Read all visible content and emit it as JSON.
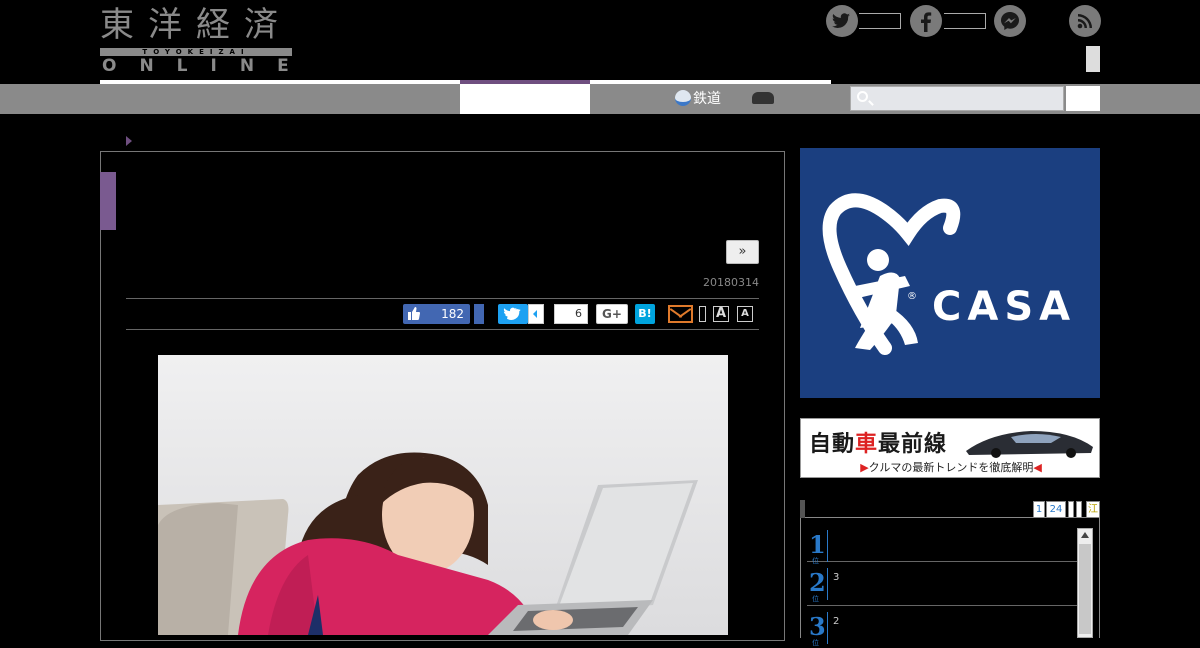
{
  "header": {
    "logo_kanji": "東洋経済",
    "logo_romaji": "TOYOKEIZAI",
    "logo_online": "ONLINE"
  },
  "social": {
    "twitter_icon": "twitter-bird-icon",
    "facebook_icon": "facebook-f-icon",
    "messenger_icon": "messenger-icon",
    "rss_icon": "rss-icon"
  },
  "nav": {
    "items": [
      {
        "label": "鉄道",
        "icon": "train-icon"
      },
      {
        "label": "",
        "icon": "car-icon"
      }
    ],
    "search_placeholder": ""
  },
  "article": {
    "next_label": "»",
    "date": "20180314",
    "like_count": "182",
    "share_count": "6",
    "gplus_label": "G+",
    "hatena_label": "B!",
    "font_large_label": "A",
    "font_small_label": "A"
  },
  "sidebar": {
    "ad_casa": {
      "brand": "CASA",
      "registered": "®",
      "colors": {
        "bg": "#1b3f80",
        "fg": "#ffffff"
      }
    },
    "ad_auto": {
      "title_1": "自動",
      "title_2": "車",
      "title_3": "最前線",
      "subtitle": "クルマの最新トレンドを徹底解明"
    },
    "ranking": {
      "tabs": [
        "1",
        "24",
        "",
        "",
        "江"
      ],
      "items": [
        {
          "rank": "1",
          "suffix": "位",
          "count": ""
        },
        {
          "rank": "2",
          "suffix": "位",
          "count": "3"
        },
        {
          "rank": "3",
          "suffix": "位",
          "count": "2"
        }
      ]
    }
  },
  "colors": {
    "accent_purple": "#6f4f80",
    "nav_gray": "#8a8a8a",
    "facebook_blue": "#4267b2",
    "twitter_blue": "#1da1f2",
    "hatena_blue": "#00a4de",
    "mail_orange": "#e07a2b",
    "rank_blue": "#2979c9"
  }
}
